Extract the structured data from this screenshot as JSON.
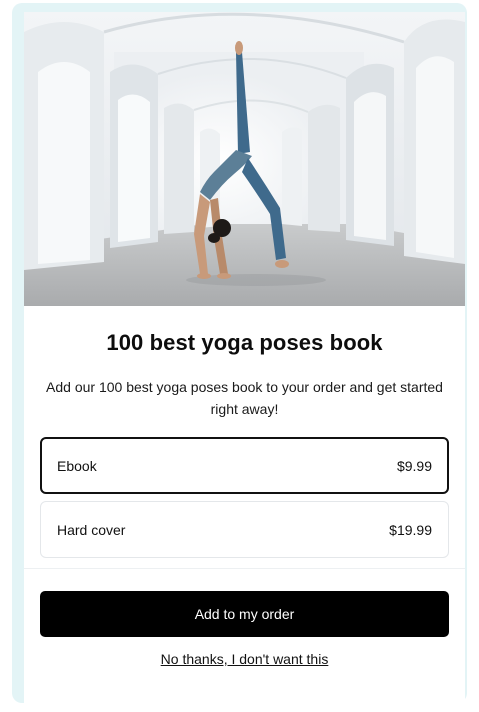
{
  "offer": {
    "image": "yoga-backbend-photo",
    "title": "100 best yoga poses book",
    "description": "Add our 100 best yoga poses book to your order and get started right away!",
    "options": [
      {
        "label": "Ebook",
        "price": "$9.99",
        "selected": true
      },
      {
        "label": "Hard cover",
        "price": "$19.99",
        "selected": false
      }
    ],
    "add_button_label": "Add to my order",
    "decline_label": "No thanks, I don't want this"
  },
  "colors": {
    "frame_background": "#e3f4f6",
    "button_background": "#000000",
    "selected_border": "#111111"
  }
}
